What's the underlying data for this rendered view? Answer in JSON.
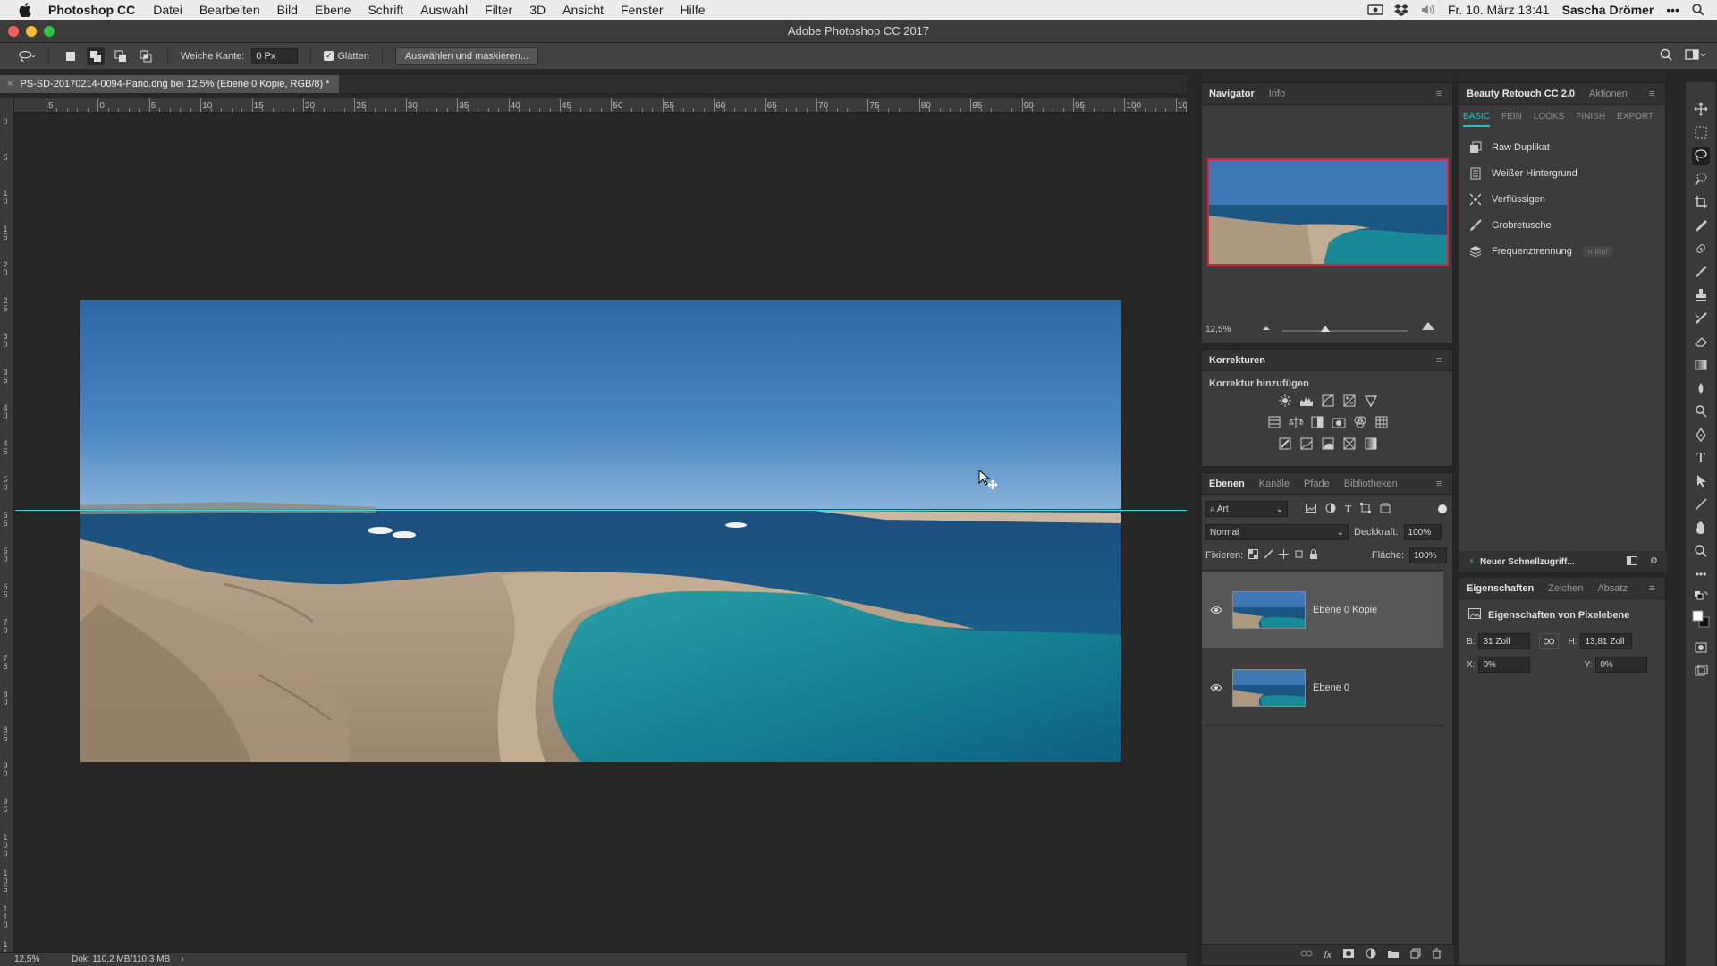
{
  "menubar": {
    "app_name": "Photoshop CC",
    "items": [
      "Datei",
      "Bearbeiten",
      "Bild",
      "Ebene",
      "Schrift",
      "Auswahl",
      "Filter",
      "3D",
      "Ansicht",
      "Fenster",
      "Hilfe"
    ],
    "datetime": "Fr. 10. März 13:41",
    "user": "Sascha Drömer"
  },
  "window": {
    "title": "Adobe Photoshop CC 2017"
  },
  "options_bar": {
    "feather_label": "Weiche Kante:",
    "feather_value": "0 Px",
    "antialias_label": "Glätten",
    "select_mask_label": "Auswählen und maskieren..."
  },
  "document": {
    "tab_title": "PS-SD-20170214-0094-Pano.dng bei 12,5% (Ebene 0 Kopie, RGB/8) *",
    "ruler_labels": [
      "5",
      "0",
      "5",
      "10",
      "15",
      "20",
      "25",
      "30",
      "35",
      "40",
      "45",
      "50",
      "55",
      "60",
      "65",
      "70",
      "75",
      "80",
      "85",
      "90",
      "95",
      "100",
      "10"
    ],
    "ruler_v_labels": [
      "0",
      "5",
      "1 0",
      "1 5",
      "2 0",
      "2 5",
      "3 0",
      "3 5",
      "4 0",
      "4 5",
      "5 0",
      "5 5",
      "6 0",
      "6 5",
      "7 0",
      "7 5",
      "8 0",
      "8 5",
      "9 0",
      "9 5",
      "1 0 0",
      "1 0 5",
      "1 1 0",
      "1 1 5"
    ],
    "zoom": "12,5%",
    "doc_size": "Dok: 110,2 MB/110,3 MB"
  },
  "navigator": {
    "tabs": [
      "Navigator",
      "Info"
    ],
    "zoom": "12,5%"
  },
  "korrekturen": {
    "title": "Korrekturen",
    "subtitle": "Korrektur hinzufügen"
  },
  "layers": {
    "tabs": [
      "Ebenen",
      "Kanäle",
      "Pfade",
      "Bibliotheken"
    ],
    "filter_kind": "Art",
    "blend_mode": "Normal",
    "opacity_label": "Deckkraft:",
    "opacity_value": "100%",
    "lock_label": "Fixieren:",
    "fill_label": "Fläche:",
    "fill_value": "100%",
    "items": [
      {
        "name": "Ebene 0 Kopie",
        "selected": true,
        "visible": true
      },
      {
        "name": "Ebene 0",
        "selected": false,
        "visible": true
      }
    ]
  },
  "beauty_retouch": {
    "tabs": [
      "Beauty Retouch CC 2.0",
      "Aktionen"
    ],
    "subtabs": [
      "BASIC",
      "FEIN",
      "LOOKS",
      "FINISH",
      "EXPORT"
    ],
    "actions": [
      {
        "label": "Raw Duplikat",
        "icon": "layers-icon"
      },
      {
        "label": "Weißer Hintergrund",
        "icon": "document-icon"
      },
      {
        "label": "Verflüssigen",
        "icon": "warp-icon"
      },
      {
        "label": "Grobretusche",
        "icon": "brush-icon"
      },
      {
        "label": "Frequenztrennung",
        "icon": "stack-icon",
        "tag": "mittel"
      }
    ],
    "quick_access": "Neuer Schnellzugriff..."
  },
  "properties": {
    "tabs": [
      "Eigenschaften",
      "Zeichen",
      "Absatz"
    ],
    "title": "Eigenschaften von Pixelebene",
    "w_label": "B:",
    "w_value": "31 Zoll",
    "h_label": "H:",
    "h_value": "13,81 Zoll",
    "x_label": "X:",
    "x_value": "0%",
    "y_label": "Y:",
    "y_value": "0%"
  },
  "colors": {
    "accent": "#25c1c7",
    "guide": "#33e0e0",
    "nav_frame": "#e0203a"
  }
}
